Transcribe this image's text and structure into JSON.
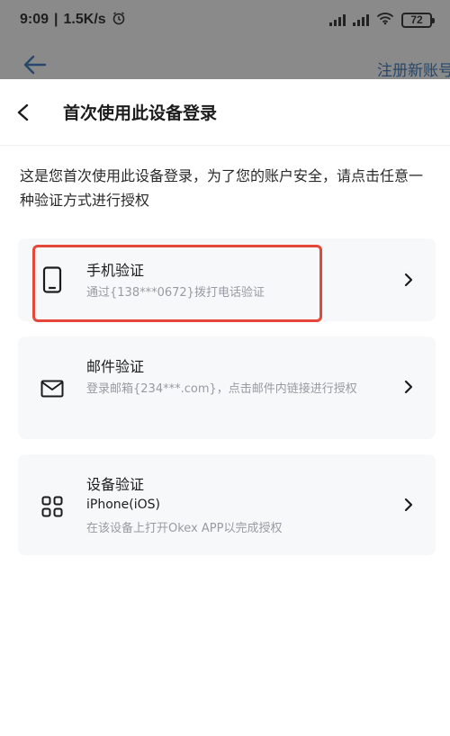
{
  "status_bar": {
    "time": "9:09",
    "speed": "1.5K/s",
    "battery": "72"
  },
  "background": {
    "register_link": "注册新账号"
  },
  "sheet": {
    "title": "首次使用此设备登录",
    "intro": "这是您首次使用此设备登录，为了您的账户安全，请点击任意一种验证方式进行授权",
    "options": [
      {
        "icon": "phone-icon",
        "title": "手机验证",
        "subtitle": "通过{138***0672}拨打电话验证"
      },
      {
        "icon": "mail-icon",
        "title": "邮件验证",
        "subtitle": "登录邮箱{234***.com}，点击邮件内链接进行授权"
      },
      {
        "icon": "devices-grid-icon",
        "title": "设备验证",
        "device": "iPhone(iOS)",
        "subtitle": "在该设备上打开Okex APP以完成授权"
      }
    ]
  },
  "colors": {
    "highlight": "#e5483a",
    "link": "#27486b",
    "card_bg": "#f7f8fa"
  }
}
